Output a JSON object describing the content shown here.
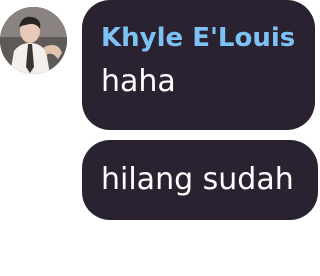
{
  "chat": {
    "sender_name": "Khyle E'Louis",
    "messages": [
      {
        "text": "haha"
      },
      {
        "text": "hilang sudah"
      }
    ]
  },
  "colors": {
    "bubble_bg": "#2a2230",
    "sender_name": "#7dc2f5",
    "message_text": "#ffffff",
    "page_bg": "#ffffff"
  },
  "icons": {
    "avatar": "profile-photo"
  }
}
